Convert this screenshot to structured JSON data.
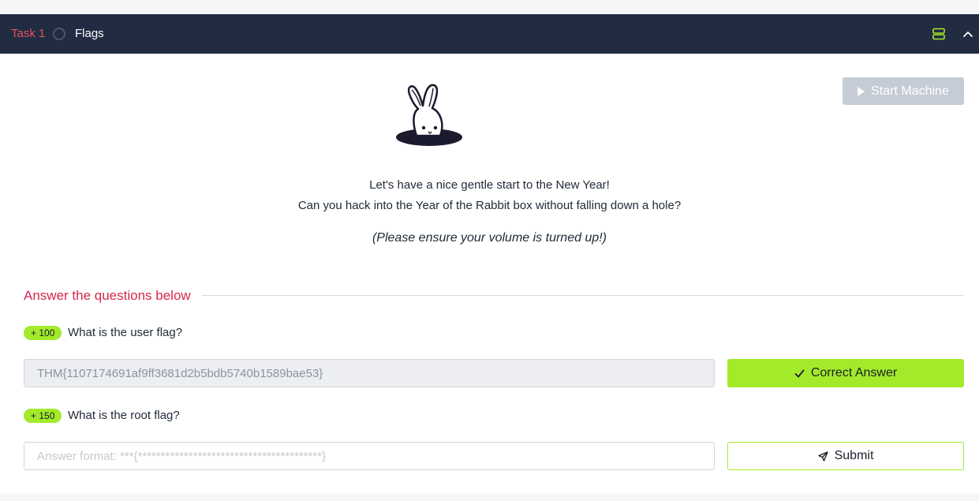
{
  "task": {
    "number": "Task 1",
    "title": "Flags",
    "status_icon": "empty-circle-icon",
    "header_icons": [
      "server-stack-icon",
      "chevron-up-icon"
    ],
    "accent_color": "#e6505e",
    "header_bg": "#212c42"
  },
  "machine": {
    "start_label": "Start Machine",
    "icon": "play-icon"
  },
  "intro": {
    "line1": "Let's have a nice gentle start to the New Year!",
    "line2": "Can you hack into the Year of the Rabbit box without falling down a hole?",
    "note": "(Please ensure your volume is turned up!)",
    "image": "rabbit-in-hole-icon"
  },
  "answers": {
    "heading": "Answer the questions below",
    "heading_color": "#d6274f",
    "questions": [
      {
        "points": "+ 100",
        "text": "What is the user flag?",
        "value": "THM{1107174691af9ff3681d2b5bdb5740b1589bae53}",
        "disabled": true,
        "button": "Correct Answer",
        "button_icon": "check-icon"
      },
      {
        "points": "+ 150",
        "text": "What is the root flag?",
        "value": "",
        "placeholder": "Answer format: ***{****************************************}",
        "disabled": false,
        "button": "Submit",
        "button_icon": "send-icon"
      }
    ],
    "success_color": "#a3ea2a"
  }
}
